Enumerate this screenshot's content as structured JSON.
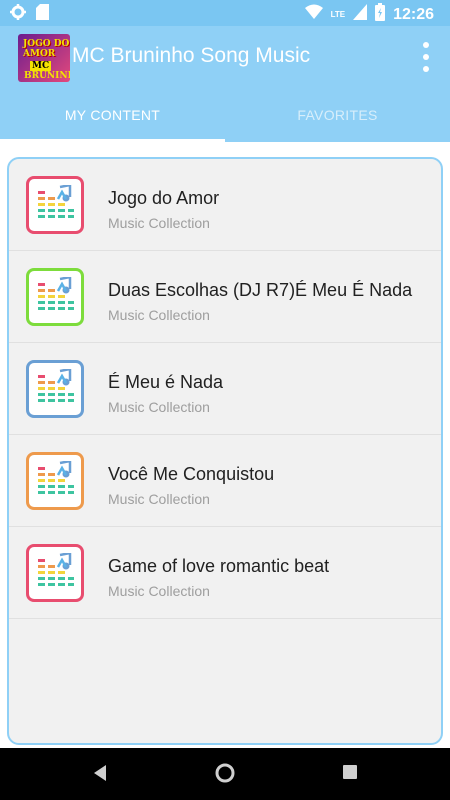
{
  "status_bar": {
    "time": "12:26",
    "network": "LTE",
    "icons": [
      "settings-icon",
      "sd-card-icon",
      "wifi-icon",
      "signal-icon",
      "battery-icon"
    ]
  },
  "app_bar": {
    "title": "MC Bruninho Song Music",
    "cover_art": {
      "line1": "JOGO DO",
      "line2": "AMOR",
      "line3": "MC",
      "line4": "BRUNINHO"
    }
  },
  "tabs": [
    {
      "label": "MY CONTENT",
      "active": true
    },
    {
      "label": "FAVORITES",
      "active": false
    }
  ],
  "songs": [
    {
      "title": "Jogo do Amor",
      "subtitle": "Music Collection",
      "border_color": "#e84d6f"
    },
    {
      "title": "Duas Escolhas (DJ R7)É Meu É Nada",
      "subtitle": "Music Collection",
      "border_color": "#7ddc3c"
    },
    {
      "title": "É Meu é Nada",
      "subtitle": "Music Collection",
      "border_color": "#6a9fd4"
    },
    {
      "title": "Você Me Conquistou",
      "subtitle": "Music Collection",
      "border_color": "#ee9a4c"
    },
    {
      "title": "Game of love romantic beat",
      "subtitle": "Music Collection",
      "border_color": "#e84d6f"
    }
  ],
  "nav_bar": {
    "icons": [
      "back-icon",
      "home-icon",
      "recents-icon"
    ]
  },
  "colors": {
    "accent": "#8fd0f6",
    "status_bar": "#7ac6f2"
  }
}
